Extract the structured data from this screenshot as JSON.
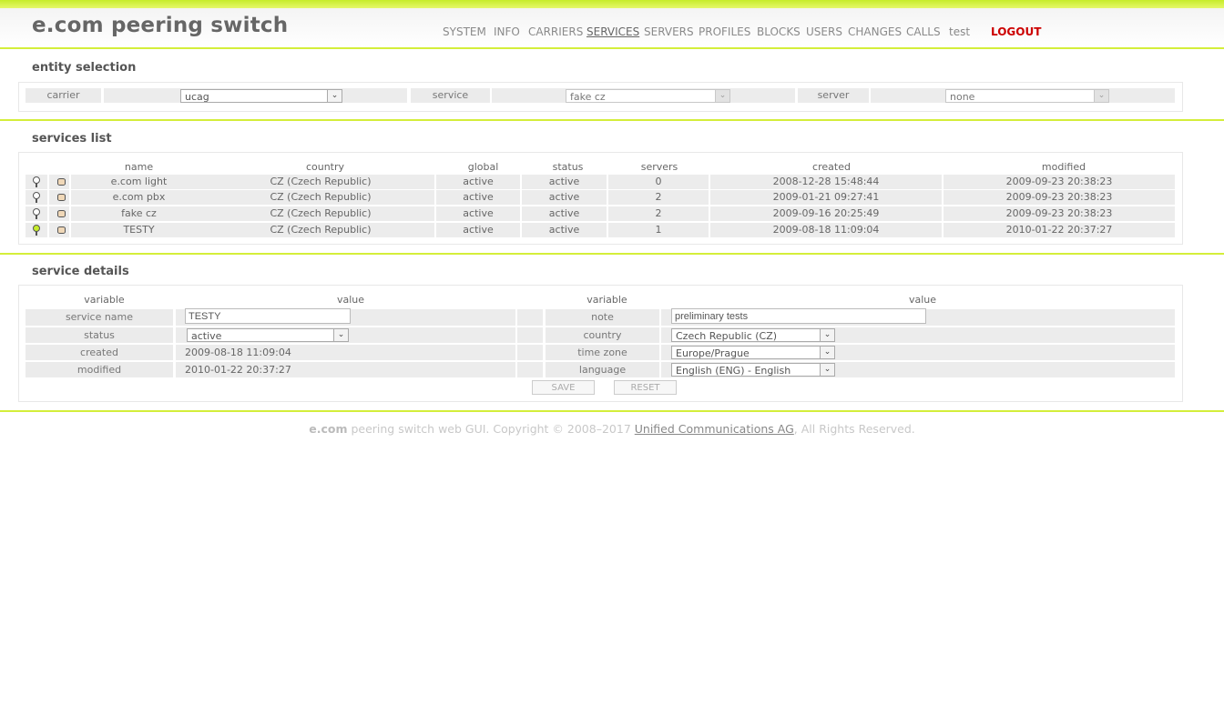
{
  "app": {
    "title": "e.com peering switch"
  },
  "nav": [
    {
      "label": "SYSTEM"
    },
    {
      "label": "INFO"
    },
    {
      "label": "CARRIERS"
    },
    {
      "label": "SERVICES"
    },
    {
      "label": "SERVERS"
    },
    {
      "label": "PROFILES"
    },
    {
      "label": "BLOCKS"
    },
    {
      "label": "USERS"
    },
    {
      "label": "CHANGES"
    },
    {
      "label": "CALLS"
    },
    {
      "label": "test"
    },
    {
      "label": "LOGOUT"
    }
  ],
  "entity_selection": {
    "title": "entity selection",
    "carrier_label": "carrier",
    "carrier_value": "ucag",
    "service_label": "service",
    "service_value": "fake cz",
    "server_label": "server",
    "server_value": "none"
  },
  "services_list": {
    "title": "services list",
    "headers": [
      "name",
      "country",
      "global",
      "status",
      "servers",
      "created",
      "modified"
    ],
    "rows": [
      {
        "name": "e.com light",
        "country": "CZ (Czech Republic)",
        "global": "active",
        "status": "active",
        "servers": "0",
        "created": "2008-12-28 15:48:44",
        "modified": "2009-09-23 20:38:23",
        "selected": false
      },
      {
        "name": "e.com pbx",
        "country": "CZ (Czech Republic)",
        "global": "active",
        "status": "active",
        "servers": "2",
        "created": "2009-01-21 09:27:41",
        "modified": "2009-09-23 20:38:23",
        "selected": false
      },
      {
        "name": "fake cz",
        "country": "CZ (Czech Republic)",
        "global": "active",
        "status": "active",
        "servers": "2",
        "created": "2009-09-16 20:25:49",
        "modified": "2009-09-23 20:38:23",
        "selected": false
      },
      {
        "name": "TESTY",
        "country": "CZ (Czech Republic)",
        "global": "active",
        "status": "active",
        "servers": "1",
        "created": "2009-08-18 11:09:04",
        "modified": "2010-01-22 20:37:27",
        "selected": true
      }
    ],
    "icons": {
      "bulb": "lightbulb-icon",
      "servers": "database-icon"
    }
  },
  "service_details": {
    "title": "service details",
    "col_variable": "variable",
    "col_value": "value",
    "left": {
      "service_name_label": "service name",
      "service_name_value": "TESTY",
      "status_label": "status",
      "status_value": "active",
      "created_label": "created",
      "created_value": "2009-08-18 11:09:04",
      "modified_label": "modified",
      "modified_value": "2010-01-22 20:37:27"
    },
    "right": {
      "note_label": "note",
      "note_value": "preliminary tests",
      "country_label": "country",
      "country_value": "Czech Republic (CZ)",
      "timezone_label": "time zone",
      "timezone_value": "Europe/Prague",
      "language_label": "language",
      "language_value": "English (ENG) - English"
    },
    "save_label": "SAVE",
    "reset_label": "RESET"
  },
  "footer": {
    "brand": "e.com",
    "text": " peering switch web GUI. Copyright © 2008–2017 ",
    "link": "Unified Communications AG",
    "tail": ", All Rights Reserved."
  },
  "colors": {
    "accent": "#d4ee3a",
    "logout": "#cc0000",
    "row_bg": "#ececec"
  }
}
